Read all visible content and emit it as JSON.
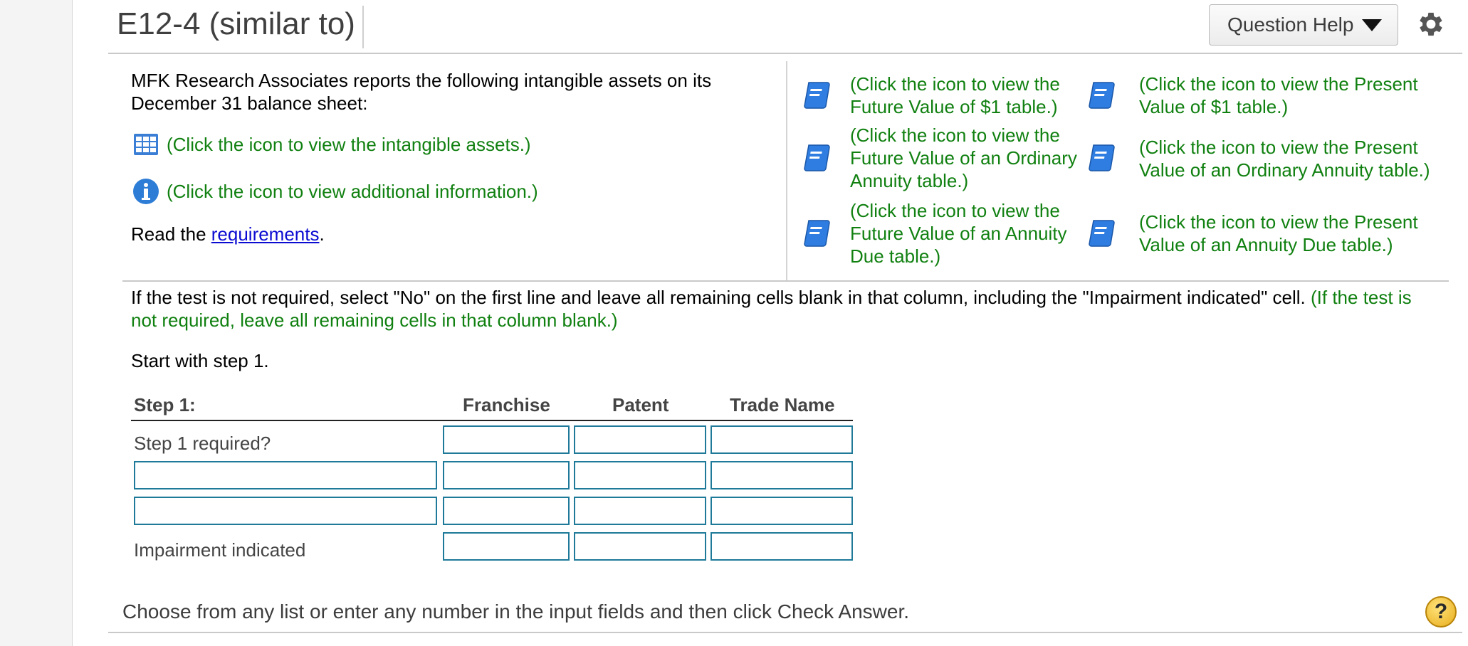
{
  "header": {
    "title": "E12-4 (similar to)",
    "question_help_label": "Question Help"
  },
  "intro": {
    "text": "MFK Research Associates reports the following intangible assets on its December 31 balance sheet:",
    "assets_link": "(Click the icon to view the intangible assets.)",
    "info_link": "(Click the icon to view additional information.)",
    "read_prefix": "Read the ",
    "requirements_link": "requirements",
    "read_suffix": "."
  },
  "tables": {
    "fv1": "(Click the icon to view the Future Value of $1 table.)",
    "pv1": "(Click the icon to view the Present Value of $1 table.)",
    "fv_oa": "(Click the icon to view the Future Value of an Ordinary Annuity table.)",
    "pv_oa": "(Click the icon to view the Present Value of an Ordinary Annuity table.)",
    "fv_ad": "(Click the icon to view the Future Value of an Annuity Due table.)",
    "pv_ad": "(Click the icon to view the Present Value of an Annuity Due table.)"
  },
  "instruction": {
    "main": "If the test is not required, select \"No\" on the first line and leave all remaining cells blank in that column, including the \"Impairment indicated\" cell. ",
    "green": "(If the test is not required, leave all remaining cells in that column blank.)"
  },
  "start_text": "Start with step 1.",
  "grid": {
    "step_label": "Step 1:",
    "columns": [
      "Franchise",
      "Patent",
      "Trade Name"
    ],
    "row1_label": "Step 1 required?",
    "row4_label": "Impairment indicated"
  },
  "footer": {
    "message": "Choose from any list or enter any number in the input fields and then click Check Answer.",
    "help_symbol": "?"
  },
  "colors": {
    "link_green": "#108010",
    "input_border": "#1f7a9a",
    "book_blue": "#2f7de1"
  }
}
